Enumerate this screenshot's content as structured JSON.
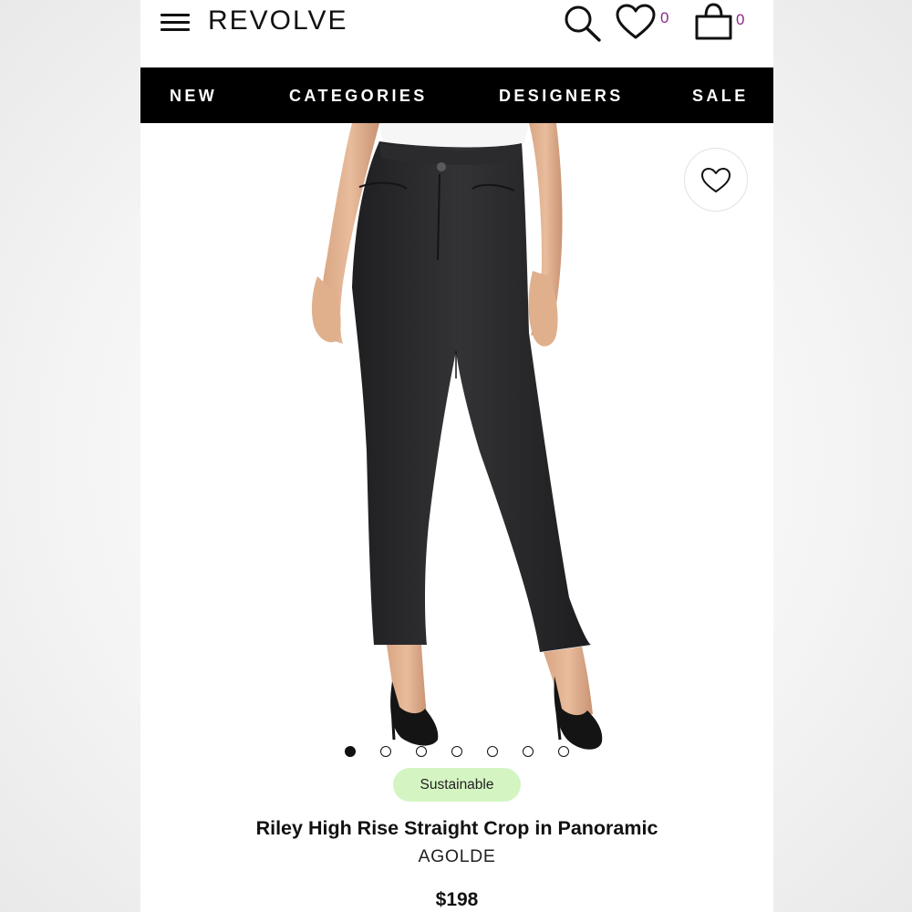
{
  "header": {
    "logo": "REVOLVE",
    "wishlist_count": "0",
    "bag_count": "0"
  },
  "nav": {
    "items": [
      {
        "label": "NEW"
      },
      {
        "label": "CATEGORIES"
      },
      {
        "label": "DESIGNERS"
      },
      {
        "label": "SALE"
      }
    ]
  },
  "gallery": {
    "total_images": 7,
    "active_index": 0
  },
  "product": {
    "badge": "Sustainable",
    "name": "Riley High Rise Straight Crop in Panoramic",
    "brand": "AGOLDE",
    "price": "$198"
  },
  "colors": {
    "nav_bg": "#000000",
    "badge_bg": "#d4f5c2",
    "count_accent": "#8a2a8a",
    "denim": "#2a2a2c"
  },
  "icons": [
    "menu-icon",
    "search-icon",
    "heart-icon",
    "shopping-bag-icon"
  ]
}
